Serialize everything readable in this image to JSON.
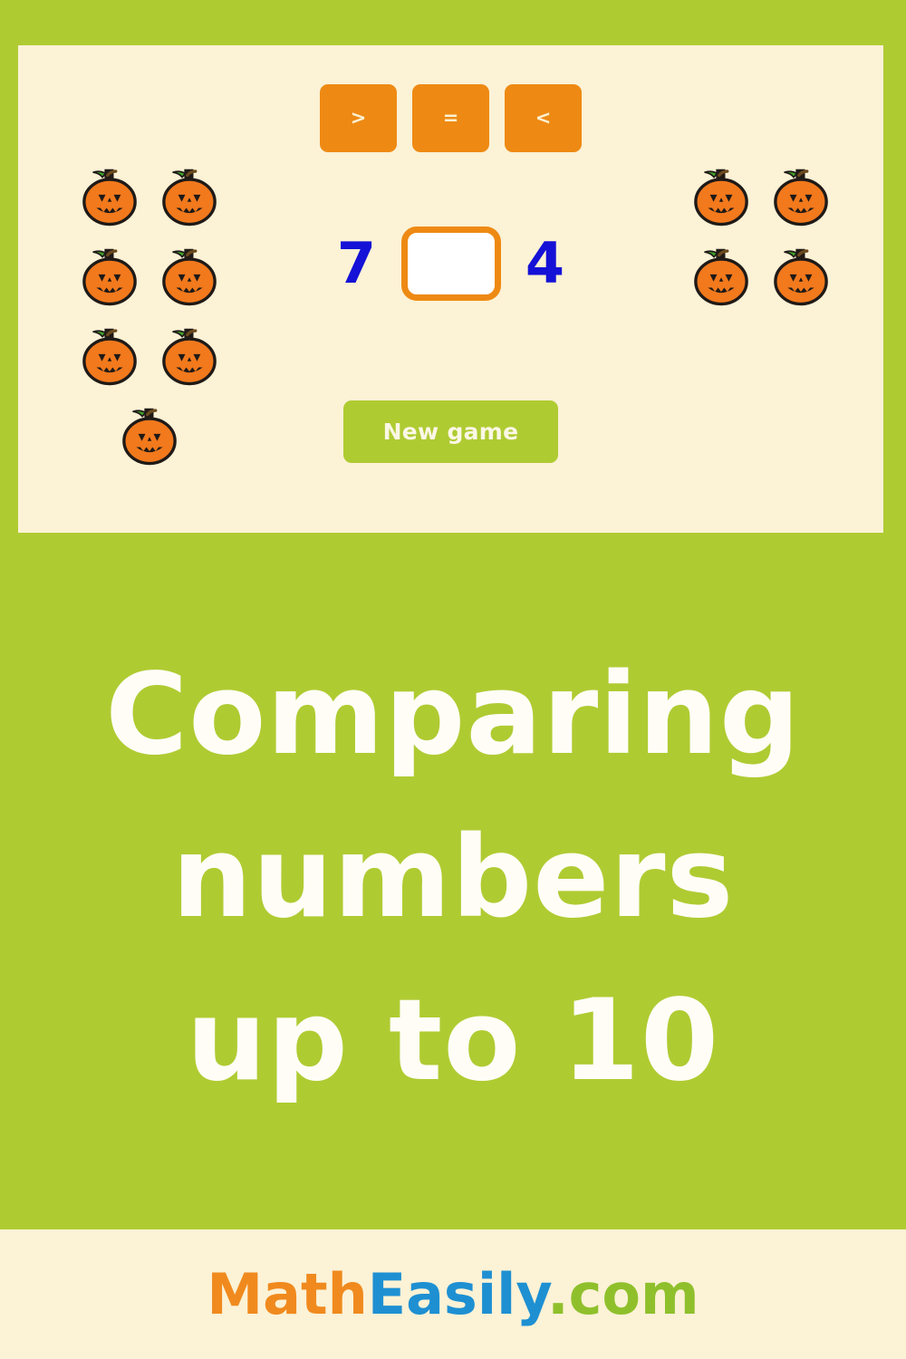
{
  "theme": {
    "green": "#AFCB32",
    "cream": "#FCF2D6",
    "orange": "#EE8A13",
    "blue": "#1511D6",
    "white": "#FFFFFF"
  },
  "game": {
    "operators": [
      {
        "id": "greater-than",
        "label": ">"
      },
      {
        "id": "equals",
        "label": "="
      },
      {
        "id": "less-than",
        "label": "<"
      }
    ],
    "left_number": "7",
    "right_number": "4",
    "answer_value": "",
    "answer_placeholder": "",
    "left_count": 7,
    "right_count": 4,
    "counter_icon": "jack-o-lantern-icon",
    "new_game_label": "New game"
  },
  "headline": {
    "line1": "Comparing",
    "line2": "numbers",
    "line3": "up to 10"
  },
  "footer": {
    "logo_part1": "Math",
    "logo_part2": "Easily",
    "logo_part3": ".com"
  }
}
